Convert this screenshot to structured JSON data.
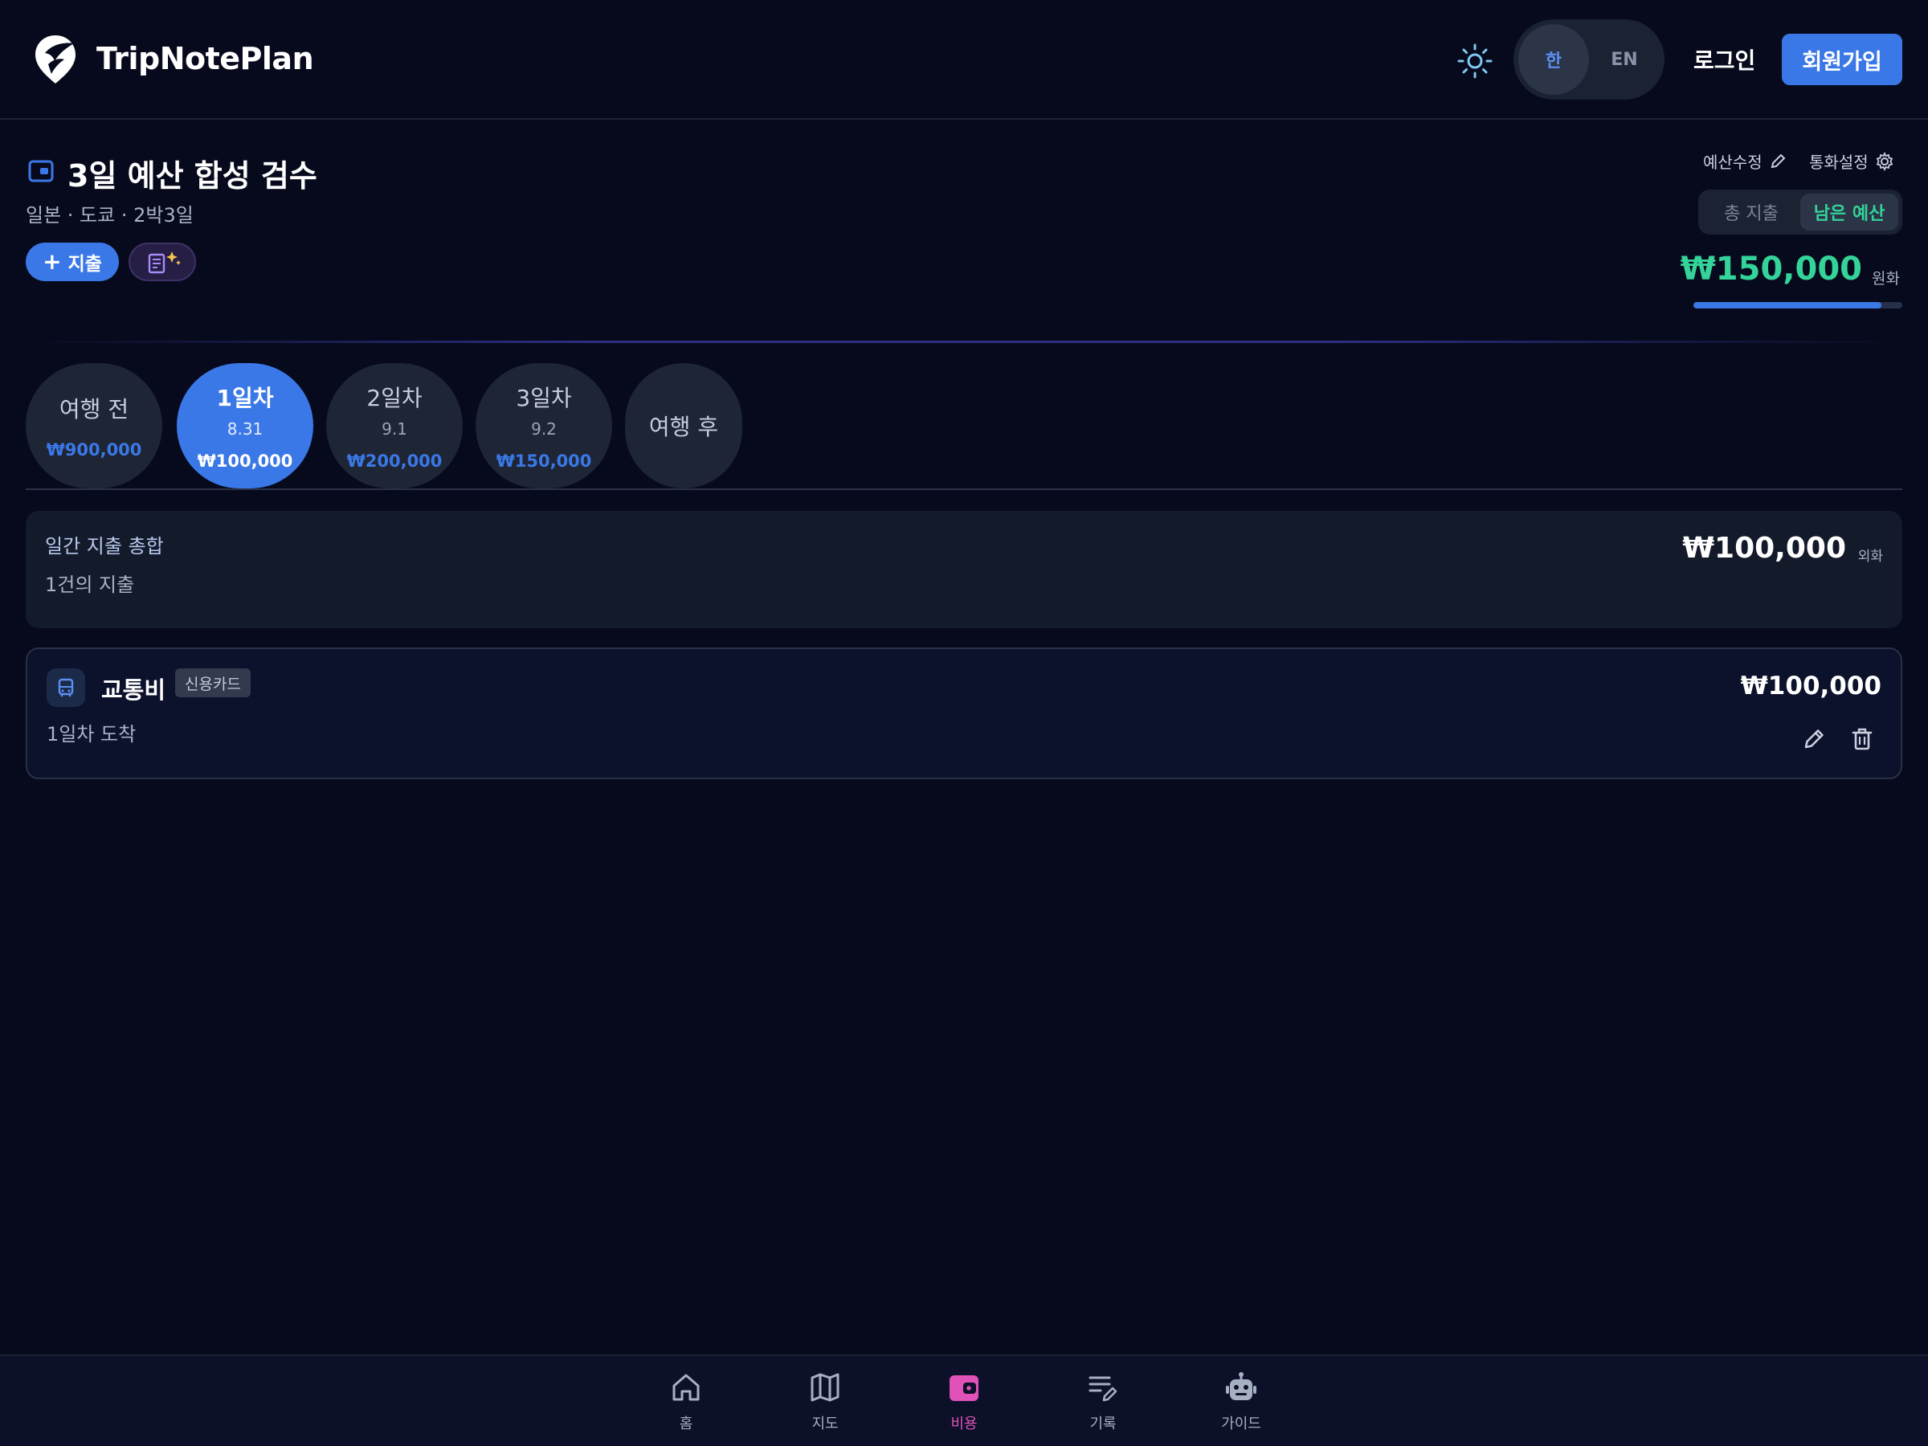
{
  "header": {
    "brand": "TripNotePlan",
    "lang_options": [
      "한",
      "EN"
    ],
    "lang_selected": "한",
    "login": "로그인",
    "signup": "회원가입"
  },
  "budget": {
    "title": "3일 예산 합성 검수",
    "subtitle": "일본 · 도쿄 · 2박3일",
    "add_expense": "지출",
    "edit_budget": "예산수정",
    "currency_settings": "통화설정",
    "view_options": [
      "총 지출",
      "남은 예산"
    ],
    "view_selected": "남은 예산",
    "remaining": "₩150,000",
    "remaining_unit": "원화",
    "remaining_fraction": 0.9
  },
  "day_tabs": [
    {
      "label": "여행 전",
      "date": "",
      "amount": "₩900,000"
    },
    {
      "label": "1일차",
      "date": "8.31",
      "amount": "₩100,000",
      "active": true
    },
    {
      "label": "2일차",
      "date": "9.1",
      "amount": "₩200,000"
    },
    {
      "label": "3일차",
      "date": "9.2",
      "amount": "₩150,000"
    },
    {
      "label": "여행 후",
      "date": "",
      "amount": ""
    }
  ],
  "daily_summary": {
    "title": "일간 지출 총합",
    "count": "1건의 지출",
    "amount": "₩100,000",
    "unit": "외화"
  },
  "expenses": [
    {
      "category": "교통비",
      "icon": "bus-icon",
      "payment": "신용카드",
      "note": "1일차 도착",
      "amount": "₩100,000"
    }
  ],
  "bottom_nav": [
    {
      "label": "홈",
      "icon": "home-icon"
    },
    {
      "label": "지도",
      "icon": "map-icon"
    },
    {
      "label": "비용",
      "icon": "wallet-icon",
      "active": true
    },
    {
      "label": "기록",
      "icon": "note-edit-icon"
    },
    {
      "label": "가이드",
      "icon": "robot-icon"
    }
  ],
  "colors": {
    "background": "#070a1c",
    "accent": "#3b78e7",
    "positive": "#34d399",
    "nav_active": "#e152b8"
  }
}
